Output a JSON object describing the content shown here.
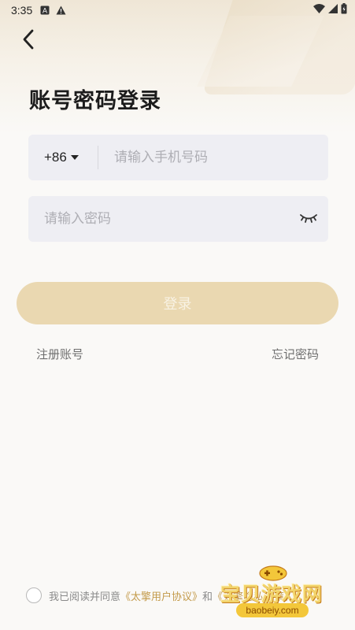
{
  "status_bar": {
    "time": "3:35",
    "icons_left": [
      "a-box-icon",
      "warning-icon"
    ],
    "icons_right": [
      "wifi-icon",
      "signal-icon",
      "battery-icon"
    ]
  },
  "nav": {
    "back_icon": "chevron-left-icon"
  },
  "title": "账号密码登录",
  "phone": {
    "country_code": "+86",
    "placeholder": "请输入手机号码",
    "value": ""
  },
  "password": {
    "placeholder": "请输入密码",
    "value": "",
    "eye_icon": "eye-closed-icon"
  },
  "login_button": "登录",
  "links": {
    "register": "注册账号",
    "forgot": "忘记密码"
  },
  "agreement": {
    "prefix": "我已阅读并同意",
    "user_agreement": "《太擎用户协议》",
    "connector": "和",
    "privacy_policy": "《太擎隐私政策》"
  },
  "watermark": {
    "brand": "宝贝游戏网",
    "domain": "baobeiy.com"
  },
  "colors": {
    "accent": "#c39a4a",
    "login_button": "#ead8b1",
    "field_bg": "#eeeef3"
  }
}
